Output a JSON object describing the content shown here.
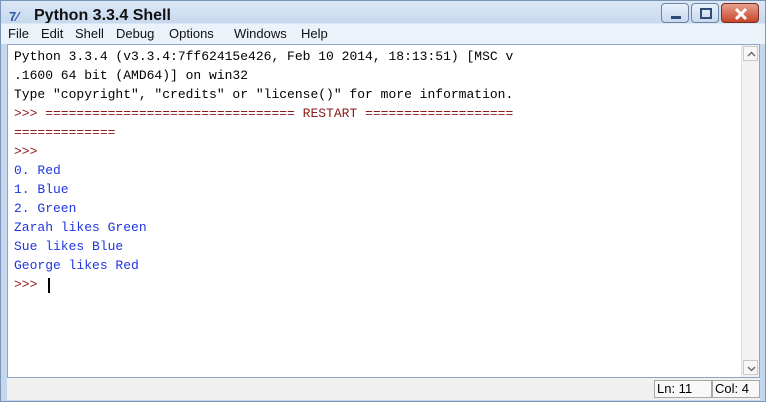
{
  "window": {
    "icon_text": "7⁄",
    "title": "Python 3.3.4 Shell"
  },
  "menu": [
    "File",
    "Edit",
    "Shell",
    "Debug",
    "Options",
    "Windows",
    "Help"
  ],
  "console": {
    "lines": [
      "Python 3.3.4 (v3.3.4:7ff62415e426, Feb 10 2014, 18:13:51) [MSC v",
      ".1600 64 bit (AMD64)] on win32",
      "Type \"copyright\", \"credits\" or \"license()\" for more information.",
      ">>> ================================ RESTART ===================",
      "=============",
      ">>>",
      "0. Red",
      "1. Blue",
      "2. Green",
      "Zarah likes Green",
      "Sue likes Blue",
      "George likes Red",
      ">>> "
    ]
  },
  "status": {
    "ln": "Ln: 11",
    "col": "Col: 4"
  }
}
